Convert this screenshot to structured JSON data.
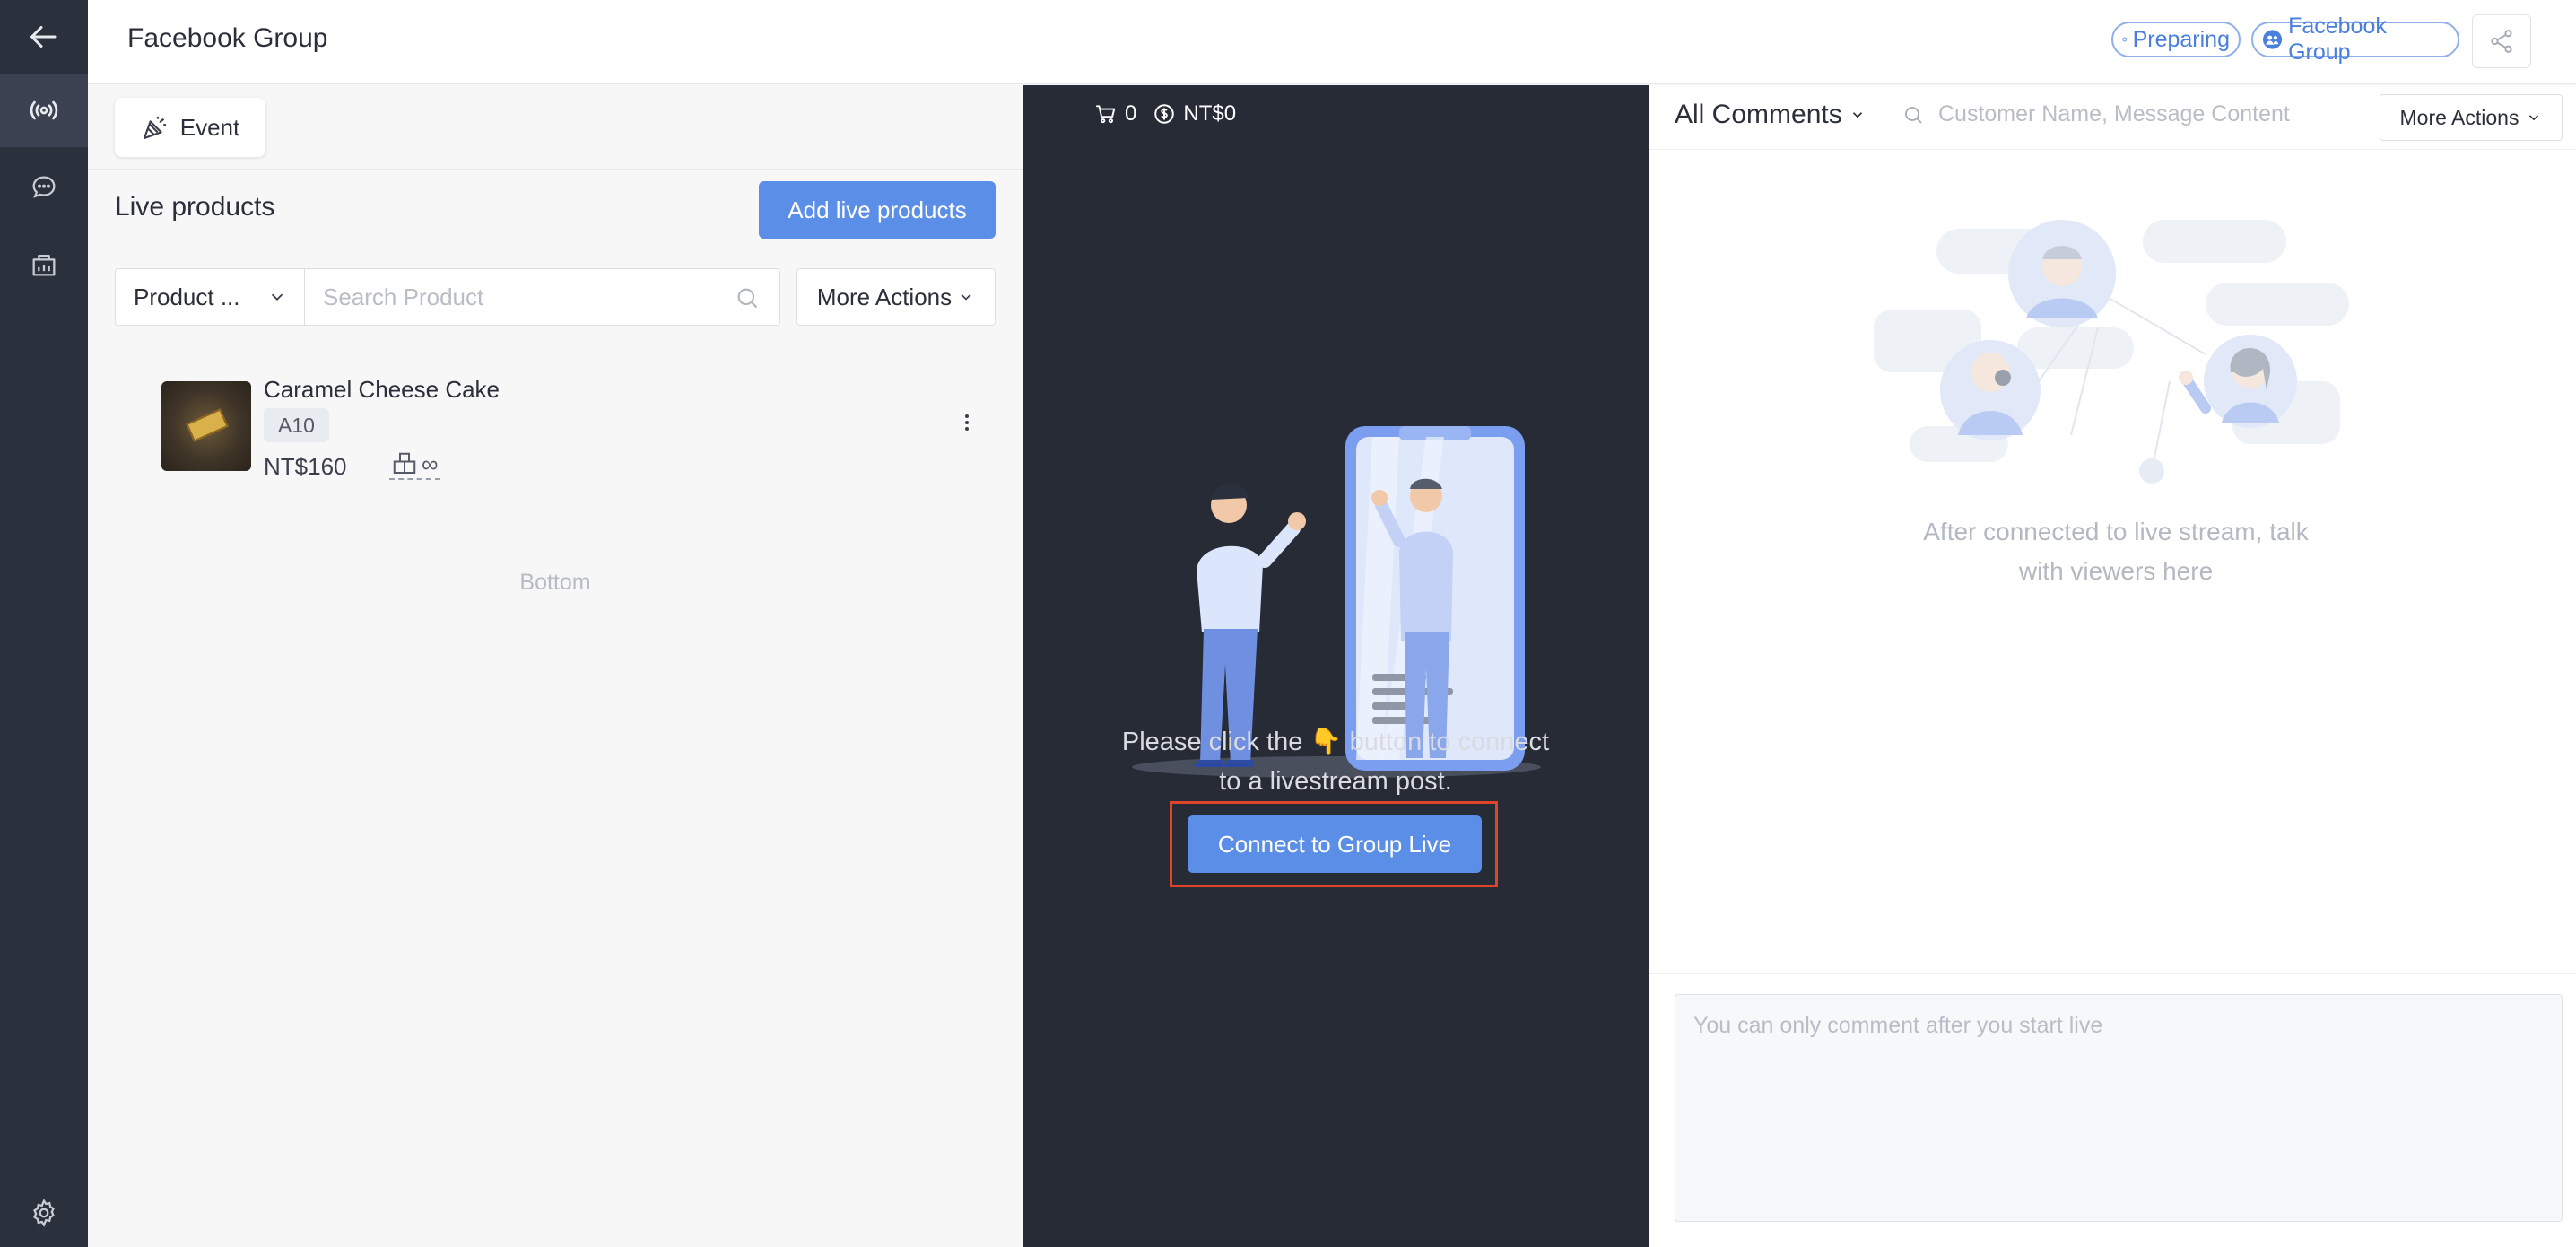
{
  "header": {
    "title": "Facebook Group",
    "status_badge": "Preparing",
    "platform_badge": "Facebook Group"
  },
  "rail": {
    "icons": [
      "back-arrow-icon",
      "live-broadcast-icon",
      "chat-bubble-icon",
      "shop-analytics-icon",
      "gear-icon"
    ]
  },
  "left": {
    "event_label": "Event",
    "live_products_title": "Live products",
    "add_button": "Add live products",
    "filter_label": "Product ...",
    "search_placeholder": "Search Product",
    "more_actions": "More Actions",
    "products": [
      {
        "name": "Caramel Cheese Cake",
        "tag": "A10",
        "price": "NT$160",
        "stock": "∞"
      }
    ],
    "bottom_text": "Bottom"
  },
  "middle": {
    "cart_count": "0",
    "revenue": "NT$0",
    "prompt_line1": "Please click the 👇 button to connect",
    "prompt_line2": "to a livestream post.",
    "connect_button": "Connect to Group Live"
  },
  "right": {
    "comments_filter": "All Comments",
    "search_placeholder": "Customer Name, Message Content",
    "more_actions": "More Actions",
    "empty_line1": "After connected to live stream, talk",
    "empty_line2": "with viewers here",
    "comment_placeholder": "You can only comment after you start live"
  },
  "colors": {
    "accent": "#5b8ee6",
    "rail_bg": "#2b303d",
    "stage_bg": "#272b36",
    "highlight": "#e0422a"
  }
}
